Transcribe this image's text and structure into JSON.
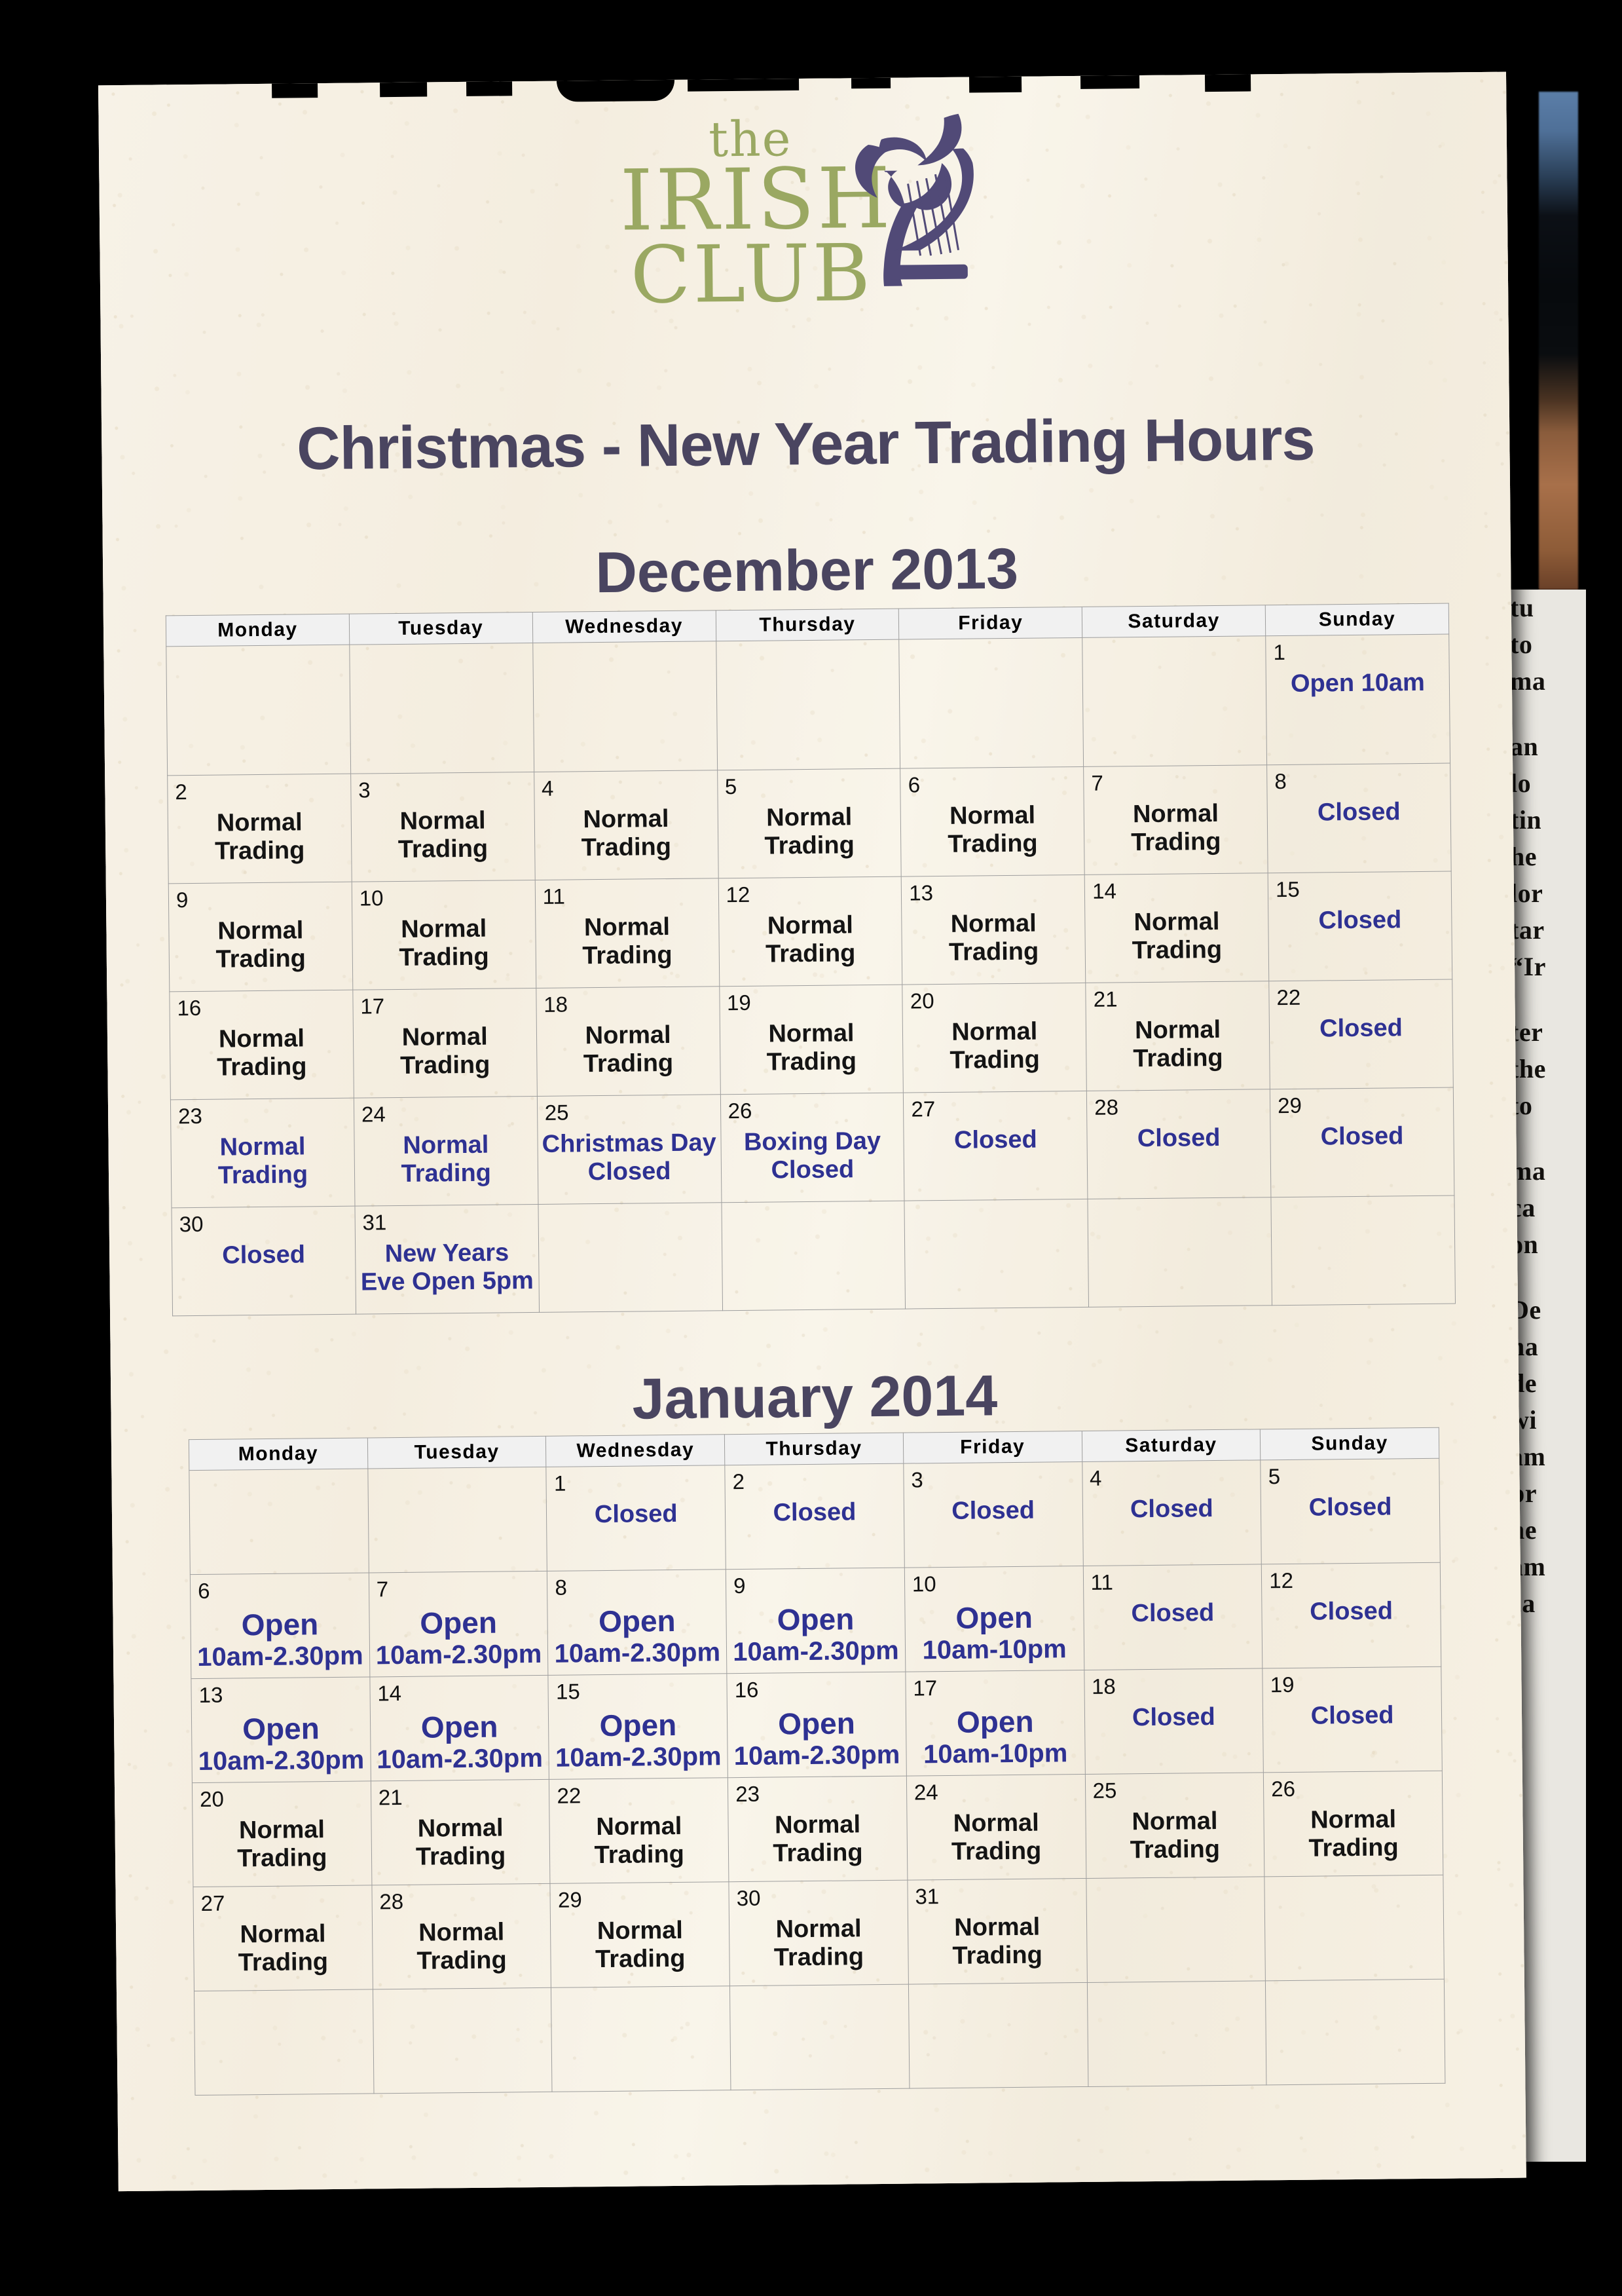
{
  "flyer": {
    "org_logo": {
      "the": "the",
      "irish": "IRISH",
      "club": "CLUB",
      "icon": "celtic-harp-icon",
      "text_color": "#9aa862",
      "harp_color": "#514a77"
    },
    "title": "Christmas - New Year Trading Hours",
    "title_color": "#4a4560",
    "accent_blue": "#2e3192",
    "paper_color": "#f6f0e3"
  },
  "calendars": [
    {
      "id": "december-2013",
      "heading": "December 2013",
      "weekday_headers": [
        "Monday",
        "Tuesday",
        "Wednesday",
        "Thursday",
        "Friday",
        "Saturday",
        "Sunday"
      ],
      "weeks": [
        [
          {
            "day": "",
            "note": "",
            "color": ""
          },
          {
            "day": "",
            "note": "",
            "color": ""
          },
          {
            "day": "",
            "note": "",
            "color": ""
          },
          {
            "day": "",
            "note": "",
            "color": ""
          },
          {
            "day": "",
            "note": "",
            "color": ""
          },
          {
            "day": "",
            "note": "",
            "color": ""
          },
          {
            "day": "1",
            "note": "Open 10am",
            "color": "blue"
          }
        ],
        [
          {
            "day": "2",
            "note": "Normal Trading",
            "color": "black"
          },
          {
            "day": "3",
            "note": "Normal Trading",
            "color": "black"
          },
          {
            "day": "4",
            "note": "Normal Trading",
            "color": "black"
          },
          {
            "day": "5",
            "note": "Normal Trading",
            "color": "black"
          },
          {
            "day": "6",
            "note": "Normal Trading",
            "color": "black"
          },
          {
            "day": "7",
            "note": "Normal Trading",
            "color": "black"
          },
          {
            "day": "8",
            "note": "Closed",
            "color": "blue"
          }
        ],
        [
          {
            "day": "9",
            "note": "Normal Trading",
            "color": "black"
          },
          {
            "day": "10",
            "note": "Normal Trading",
            "color": "black"
          },
          {
            "day": "11",
            "note": "Normal Trading",
            "color": "black"
          },
          {
            "day": "12",
            "note": "Normal Trading",
            "color": "black"
          },
          {
            "day": "13",
            "note": "Normal Trading",
            "color": "black"
          },
          {
            "day": "14",
            "note": "Normal Trading",
            "color": "black"
          },
          {
            "day": "15",
            "note": "Closed",
            "color": "blue"
          }
        ],
        [
          {
            "day": "16",
            "note": "Normal Trading",
            "color": "black"
          },
          {
            "day": "17",
            "note": "Normal Trading",
            "color": "black"
          },
          {
            "day": "18",
            "note": "Normal Trading",
            "color": "black"
          },
          {
            "day": "19",
            "note": "Normal Trading",
            "color": "black"
          },
          {
            "day": "20",
            "note": "Normal Trading",
            "color": "black"
          },
          {
            "day": "21",
            "note": "Normal Trading",
            "color": "black"
          },
          {
            "day": "22",
            "note": "Closed",
            "color": "blue"
          }
        ],
        [
          {
            "day": "23",
            "note": "Normal Trading",
            "color": "blue"
          },
          {
            "day": "24",
            "note": "Normal Trading",
            "color": "blue"
          },
          {
            "day": "25",
            "note": "Christmas Day Closed",
            "color": "blue"
          },
          {
            "day": "26",
            "note": "Boxing Day Closed",
            "color": "blue"
          },
          {
            "day": "27",
            "note": "Closed",
            "color": "blue"
          },
          {
            "day": "28",
            "note": "Closed",
            "color": "blue"
          },
          {
            "day": "29",
            "note": "Closed",
            "color": "blue"
          }
        ],
        [
          {
            "day": "30",
            "note": "Closed",
            "color": "blue"
          },
          {
            "day": "31",
            "note": "New Years Eve Open 5pm",
            "color": "blue"
          },
          {
            "day": "",
            "note": "",
            "color": ""
          },
          {
            "day": "",
            "note": "",
            "color": ""
          },
          {
            "day": "",
            "note": "",
            "color": ""
          },
          {
            "day": "",
            "note": "",
            "color": ""
          },
          {
            "day": "",
            "note": "",
            "color": ""
          }
        ]
      ]
    },
    {
      "id": "january-2014",
      "heading": "January 2014",
      "weekday_headers": [
        "Monday",
        "Tuesday",
        "Wednesday",
        "Thursday",
        "Friday",
        "Saturday",
        "Sunday"
      ],
      "weeks": [
        [
          {
            "day": "",
            "note": "",
            "color": ""
          },
          {
            "day": "",
            "note": "",
            "color": ""
          },
          {
            "day": "1",
            "note": "Closed",
            "color": "blue"
          },
          {
            "day": "2",
            "note": "Closed",
            "color": "blue"
          },
          {
            "day": "3",
            "note": "Closed",
            "color": "blue"
          },
          {
            "day": "4",
            "note": "Closed",
            "color": "blue"
          },
          {
            "day": "5",
            "note": "Closed",
            "color": "blue"
          }
        ],
        [
          {
            "day": "6",
            "note": "Open",
            "sub": "10am-2.30pm",
            "color": "blue"
          },
          {
            "day": "7",
            "note": "Open",
            "sub": "10am-2.30pm",
            "color": "blue"
          },
          {
            "day": "8",
            "note": "Open",
            "sub": "10am-2.30pm",
            "color": "blue"
          },
          {
            "day": "9",
            "note": "Open",
            "sub": "10am-2.30pm",
            "color": "blue"
          },
          {
            "day": "10",
            "note": "Open",
            "sub": "10am-10pm",
            "color": "blue"
          },
          {
            "day": "11",
            "note": "Closed",
            "color": "blue"
          },
          {
            "day": "12",
            "note": "Closed",
            "color": "blue"
          }
        ],
        [
          {
            "day": "13",
            "note": "Open",
            "sub": "10am-2.30pm",
            "color": "blue"
          },
          {
            "day": "14",
            "note": "Open",
            "sub": "10am-2.30pm",
            "color": "blue"
          },
          {
            "day": "15",
            "note": "Open",
            "sub": "10am-2.30pm",
            "color": "blue"
          },
          {
            "day": "16",
            "note": "Open",
            "sub": "10am-2.30pm",
            "color": "blue"
          },
          {
            "day": "17",
            "note": "Open",
            "sub": "10am-10pm",
            "color": "blue"
          },
          {
            "day": "18",
            "note": "Closed",
            "color": "blue"
          },
          {
            "day": "19",
            "note": "Closed",
            "color": "blue"
          }
        ],
        [
          {
            "day": "20",
            "note": "Normal Trading",
            "color": "black"
          },
          {
            "day": "21",
            "note": "Normal Trading",
            "color": "black"
          },
          {
            "day": "22",
            "note": "Normal Trading",
            "color": "black"
          },
          {
            "day": "23",
            "note": "Normal Trading",
            "color": "black"
          },
          {
            "day": "24",
            "note": "Normal Trading",
            "color": "black"
          },
          {
            "day": "25",
            "note": "Normal Trading",
            "color": "black"
          },
          {
            "day": "26",
            "note": "Normal Trading",
            "color": "black"
          }
        ],
        [
          {
            "day": "27",
            "note": "Normal Trading",
            "color": "black"
          },
          {
            "day": "28",
            "note": "Normal Trading",
            "color": "black"
          },
          {
            "day": "29",
            "note": "Normal Trading",
            "color": "black"
          },
          {
            "day": "30",
            "note": "Normal Trading",
            "color": "black"
          },
          {
            "day": "31",
            "note": "Normal Trading",
            "color": "black"
          },
          {
            "day": "",
            "note": "",
            "color": ""
          },
          {
            "day": "",
            "note": "",
            "color": ""
          }
        ],
        [
          {
            "day": "",
            "note": "",
            "color": ""
          },
          {
            "day": "",
            "note": "",
            "color": ""
          },
          {
            "day": "",
            "note": "",
            "color": ""
          },
          {
            "day": "",
            "note": "",
            "color": ""
          },
          {
            "day": "",
            "note": "",
            "color": ""
          },
          {
            "day": "",
            "note": "",
            "color": ""
          },
          {
            "day": "",
            "note": "",
            "color": ""
          }
        ]
      ]
    }
  ],
  "newsprint_column": {
    "fragments_top": [
      "tu",
      "to",
      "ma",
      "an",
      "lo",
      "tin",
      "he",
      "lor",
      "tar",
      "“Ir",
      "ter",
      "the",
      "to"
    ],
    "fragments_bottom": [
      "ma",
      "ca",
      "on",
      "De",
      "ha",
      "de",
      "wi",
      "am",
      "pr",
      "ne",
      "am",
      "ca"
    ]
  }
}
